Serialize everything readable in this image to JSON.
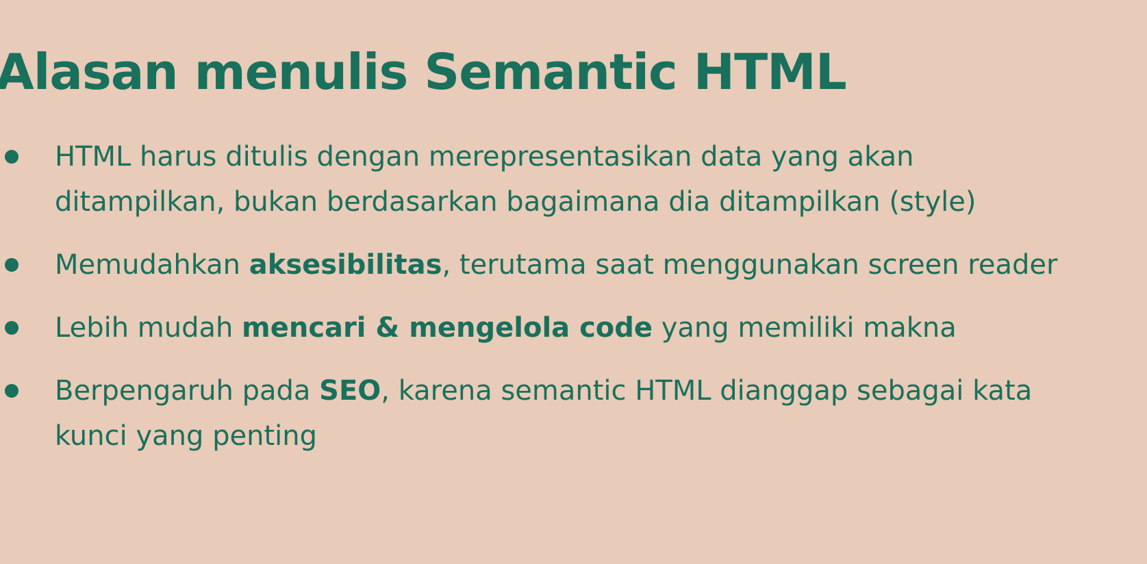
{
  "colors": {
    "background": "#E8CBB8",
    "text": "#19705C"
  },
  "slide": {
    "title": "Alasan menulis Semantic HTML",
    "bullets": [
      {
        "line1": "HTML harus ditulis dengan merepresentasikan data yang akan",
        "line2": "ditampilkan, bukan berdasarkan bagaimana dia ditampilkan (style)"
      },
      {
        "before": "Memudahkan ",
        "bold": "aksesibilitas",
        "after": ", terutama saat menggunakan screen reader"
      },
      {
        "before": "Lebih mudah ",
        "bold": "mencari & mengelola code",
        "after": " yang memiliki makna"
      },
      {
        "before": "Berpengaruh pada ",
        "bold": "SEO",
        "after": ", karena semantic HTML dianggap sebagai kata",
        "line2": "kunci yang penting"
      }
    ]
  }
}
